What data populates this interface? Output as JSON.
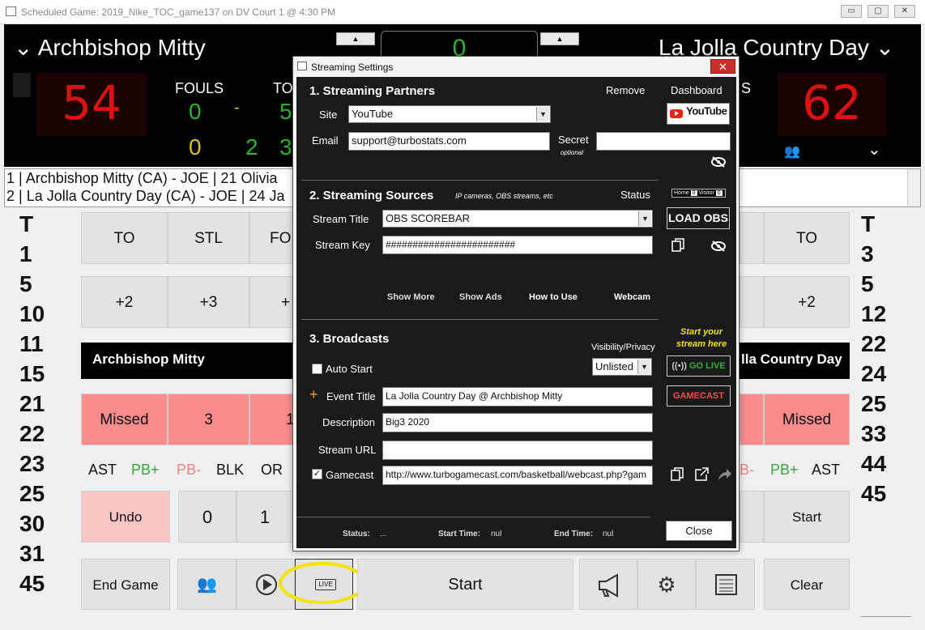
{
  "window": {
    "title": "Scheduled Game: 2019_Nike_TOC_game137 on DV Court 1 @ 4:30 PM",
    "minimize": "▭",
    "maximize": "▢",
    "close": "✕"
  },
  "scoreboard": {
    "home_name": "Archbishop Mitty",
    "away_name": "La Jolla Country Day",
    "home_score": "54",
    "away_score": "62",
    "fouls_label": "FOULS",
    "to_label": "TO",
    "s_label": "S",
    "clock_digit": "0",
    "home_fouls": "0",
    "home_fouls_sep": "-",
    "home_to": "5",
    "home_bonus": "0",
    "home_to2": "2",
    "home_to3": "3"
  },
  "log": {
    "line1": "1 | Archbishop Mitty (CA) - JOE | 21 Olivia",
    "line2": "2 | La Jolla Country Day (CA) - JOE | 24 Ja"
  },
  "left_roster": [
    "T",
    "1",
    "5",
    "10",
    "11",
    "15",
    "21",
    "22",
    "23",
    "25",
    "30",
    "31",
    "45"
  ],
  "right_roster": [
    "T",
    "3",
    "5",
    "12",
    "22",
    "24",
    "25",
    "33",
    "44",
    "45"
  ],
  "left_actions": {
    "to": "TO",
    "stl": "STL",
    "fo": "FO",
    "p2": "+2",
    "p3": "+3",
    "p_": "+",
    "team": "Archbishop Mitty",
    "missed": "Missed",
    "three": "3",
    "one": "1",
    "ast": "AST",
    "pbp": "PB+",
    "pbm": "PB-",
    "blk": "BLK",
    "or": "OR",
    "undo": "Undo",
    "zero": "0",
    "onebtn": "1"
  },
  "right_actions": {
    "to": "TO",
    "p2": "+2",
    "team": "lla Country Day",
    "missed": "Missed",
    "bm": "B-",
    "pbp": "PB+",
    "ast": "AST",
    "start": "Start"
  },
  "bottom": {
    "end_game": "End Game",
    "live": "LIVE",
    "start": "Start",
    "clear": "Clear"
  },
  "dialog": {
    "title": "Streaming Settings",
    "close_x": "✕",
    "sec1": "1. Streaming Partners",
    "remove": "Remove",
    "dashboard": "Dashboard",
    "site_label": "Site",
    "site_value": "YouTube",
    "youtube_btn": "YouTube",
    "email_label": "Email",
    "email_value": "support@turbostats.com",
    "secret_label": "Secret",
    "secret_sub": "optional",
    "secret_value": "",
    "sec2": "2. Streaming Sources",
    "sec2_note": "IP cameras, OBS streams, etc",
    "status_label": "Status",
    "home_tag": "Home",
    "home_num": "0",
    "visitor_tag": "Visitor",
    "visitor_num": "0",
    "stream_title_label": "Stream Title",
    "stream_title_value": "OBS SCOREBAR",
    "load_obs": "LOAD OBS",
    "stream_key_label": "Stream Key",
    "stream_key_value": "########################",
    "show_more": "Show More",
    "show_ads": "Show Ads",
    "how_to_use": "How to Use",
    "webcam": "Webcam",
    "sec3": "3. Broadcasts",
    "start_stream_1": "Start your",
    "start_stream_2": "stream here",
    "visibility_label": "Visibility/Privacy",
    "visibility_value": "Unlisted",
    "auto_start": "Auto Start",
    "go_live": "GO LIVE",
    "plus": "+",
    "event_title_label": "Event Title",
    "event_title_value": "La Jolla Country Day @ Archbishop Mitty",
    "gamecast_btn": "GAMECAST",
    "description_label": "Description",
    "description_value": "Big3 2020",
    "stream_url_label": "Stream URL",
    "stream_url_value": "",
    "gamecast_label": "Gamecast",
    "gamecast_url": "http://www.turbogamecast.com/basketball/webcast.php?gam",
    "status_key": "Status:",
    "status_val": "...",
    "start_time_key": "Start Time:",
    "start_time_val": "nul",
    "end_time_key": "End Time:",
    "end_time_val": "nul",
    "close_btn": "Close"
  }
}
